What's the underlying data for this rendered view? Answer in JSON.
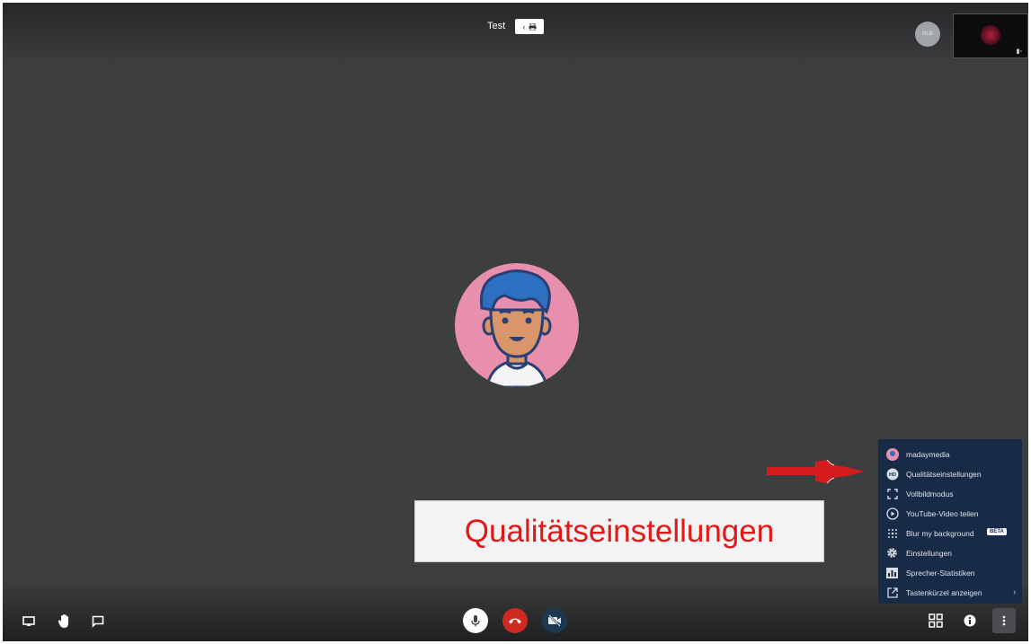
{
  "header": {
    "meeting_title": "Test",
    "copy_pill_icon": "lock-icon",
    "remote_participant_initials": "RLB"
  },
  "local_video": {
    "icon": "camera-indicator-icon"
  },
  "overflow_menu": {
    "items": [
      {
        "label": "madaymedia",
        "icon": "user-avatar-icon"
      },
      {
        "label": "Qualitätseinstellungen",
        "icon": "hd-icon"
      },
      {
        "label": "Vollbildmodus",
        "icon": "fullscreen-icon"
      },
      {
        "label": "YouTube-Video teilen",
        "icon": "play-circle-icon"
      },
      {
        "label": "Blur my background",
        "icon": "blur-icon",
        "badge": "BETA"
      },
      {
        "label": "Einstellungen",
        "icon": "gear-icon"
      },
      {
        "label": "Sprecher-Statistiken",
        "icon": "bar-chart-icon"
      },
      {
        "label": "Tastenkürzel anzeigen",
        "icon": "external-link-icon"
      }
    ],
    "background_color": "#172a46"
  },
  "toolbar": {
    "left": [
      "screen-share-icon",
      "raise-hand-icon",
      "chat-icon"
    ],
    "center": [
      "microphone-icon",
      "hangup-icon",
      "camera-off-icon"
    ],
    "right": [
      "tile-view-icon",
      "info-icon",
      "more-options-icon"
    ],
    "hangup_color": "#cf2a20"
  },
  "annotation": {
    "callout_text": "Qualitätseinstellungen",
    "color": "#e01818"
  }
}
